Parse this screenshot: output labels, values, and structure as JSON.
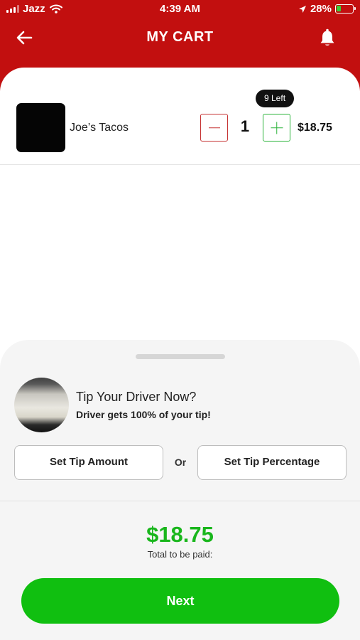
{
  "status_bar": {
    "carrier": "Jazz",
    "time": "4:39 AM",
    "battery": "28%"
  },
  "header": {
    "title": "MY CART"
  },
  "cart": {
    "items": [
      {
        "name": "Joe’s Tacos",
        "quantity": "1",
        "stock_badge": "9 Left",
        "price": "$18.75"
      }
    ]
  },
  "tip": {
    "title": "Tip Your Driver Now?",
    "subtitle": "Driver gets 100% of your tip!",
    "amount_button": "Set Tip Amount",
    "or_label": "Or",
    "percentage_button": "Set Tip Percentage"
  },
  "summary": {
    "total": "$18.75",
    "total_label": "Total to be paid:",
    "next_button": "Next"
  },
  "colors": {
    "header_red": "#c20f0f",
    "accent_green": "#10bf10",
    "minus_red": "#c63434",
    "plus_green": "#2bb33a"
  },
  "icons": [
    "back-arrow-icon",
    "bell-icon",
    "wifi-icon",
    "location-arrow-icon",
    "battery-icon",
    "cellular-signal-icon"
  ]
}
